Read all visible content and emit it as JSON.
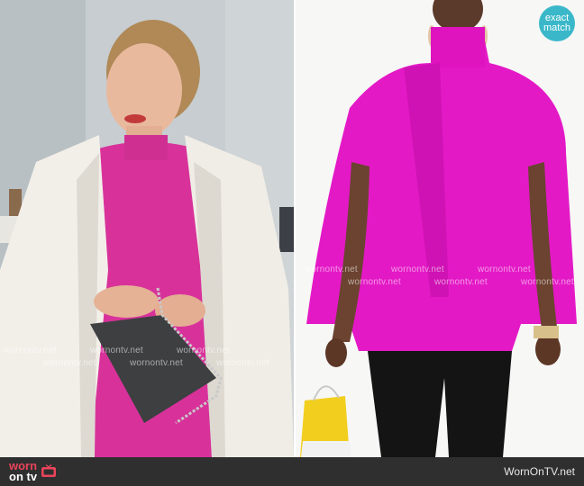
{
  "badge": {
    "line1": "exact",
    "line2": "match",
    "color": "#3ab8c9"
  },
  "watermark": {
    "text": "wornontv.net"
  },
  "footer": {
    "logo_line1": "worn",
    "logo_line2": "on tv",
    "site": "WornOnTV.net",
    "background": "#2f2f2f",
    "logo_color": "#e9445a"
  },
  "colors": {
    "cape_pink": "#e419c6",
    "dress_pink": "#d8329a",
    "coat_white": "#f2efe9"
  },
  "icons": [
    "tv-icon"
  ]
}
